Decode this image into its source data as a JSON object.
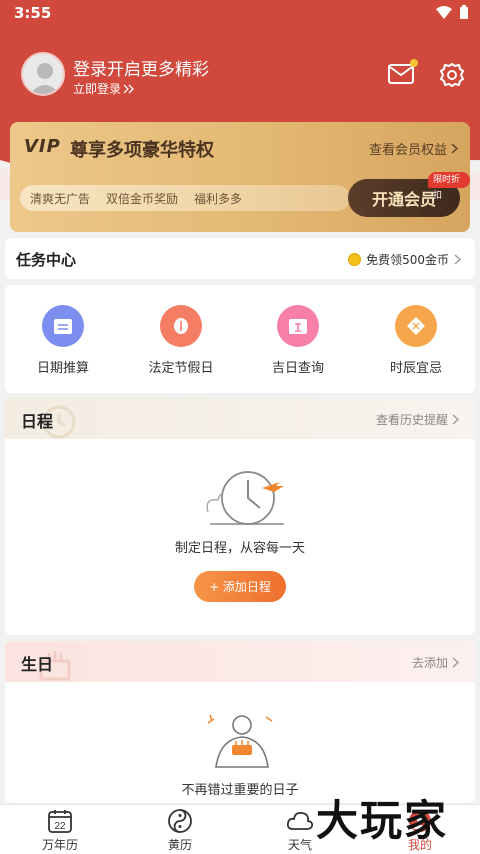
{
  "status": {
    "time": "3:55"
  },
  "profile": {
    "login_title": "登录开启更多精彩",
    "login_sub": "立即登录"
  },
  "vip": {
    "tag": "VIP",
    "title": "尊享多项豪华特权",
    "link": "查看会员权益",
    "perks": [
      "清爽无广告",
      "双倍金币奖励",
      "福利多多"
    ],
    "open_button": "开通会员",
    "badge": "限时折扣"
  },
  "tasks": {
    "title": "任务中心",
    "reward": "免费领500金币"
  },
  "tools": [
    {
      "label": "日期推算",
      "icon": "calendar-calc-icon",
      "color": "#7c8ff1"
    },
    {
      "label": "法定节假日",
      "icon": "lantern-icon",
      "color": "#f47d64"
    },
    {
      "label": "吉日查询",
      "icon": "lucky-day-icon",
      "color": "#f87fa6"
    },
    {
      "label": "时辰宜忌",
      "icon": "hour-icon",
      "color": "#f7a54b"
    }
  ],
  "schedule": {
    "title": "日程",
    "link": "查看历史提醒",
    "empty_text": "制定日程，从容每一天",
    "add_button": "+ 添加日程"
  },
  "birthday": {
    "title": "生日",
    "link": "去添加",
    "empty_text": "不再错过重要的日子"
  },
  "tabbar": {
    "calendar_day": "22",
    "tabs": [
      "万年历",
      "黄历",
      "天气",
      "我的"
    ],
    "active_index": 3
  },
  "watermark": "大玩家",
  "colors": {
    "brand_red": "#d0493c",
    "vip_gold": "#e3b873",
    "accent_orange": "#ef6f2e"
  }
}
